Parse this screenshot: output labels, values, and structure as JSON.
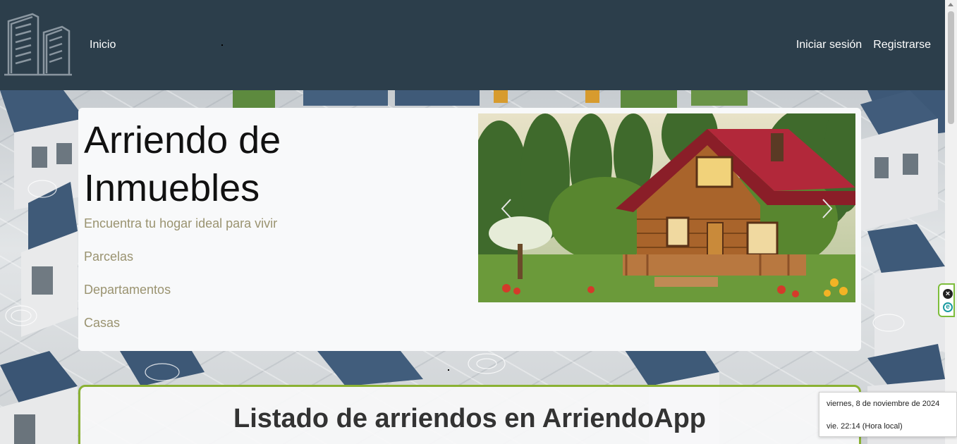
{
  "navbar": {
    "home_label": "Inicio",
    "login_label": "Iniciar sesión",
    "register_label": "Registrarse",
    "background_color": "#2c3e4b"
  },
  "hero": {
    "title": "Arriendo de Inmuebles",
    "subtitle": "Encuentra tu hogar ideal para vivir",
    "links": [
      "Parcelas",
      "Departamentos",
      "Casas"
    ],
    "link_color": "#9a9370"
  },
  "carousel": {
    "prev_icon": "chevron-left-icon",
    "next_icon": "chevron-right-icon"
  },
  "listing": {
    "title": "Listado de arriendos en ArriendoApp",
    "border_color": "#8ab133"
  },
  "side_widget": {
    "close_icon": "close-icon",
    "extension_icon": "e-extension-icon"
  },
  "clock": {
    "date": "viernes, 8 de noviembre de 2024",
    "time": "vie. 22:14 (Hora local)"
  }
}
